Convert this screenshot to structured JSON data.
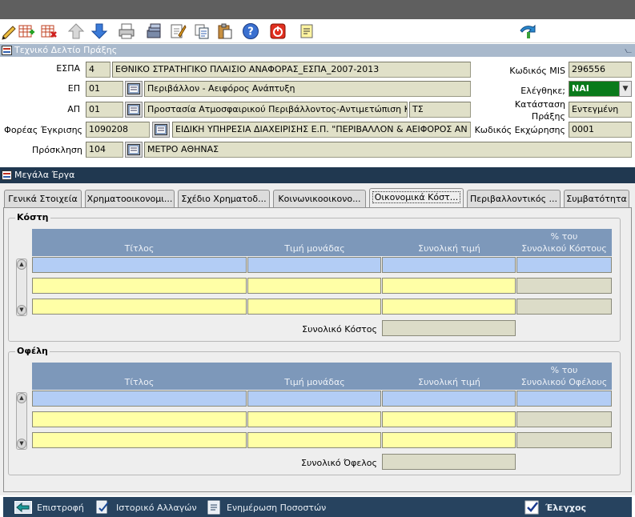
{
  "form": {
    "header_title": "Τεχνικό Δελτίο Πράξης",
    "espa_label": "ΕΣΠΑ",
    "espa_code": "4",
    "espa_desc": "ΕΘΝΙΚΟ ΣΤΡΑΤΗΓΙΚΟ ΠΛΑΙΣΙΟ ΑΝΑΦΟΡΑΣ_ΕΣΠΑ_2007-2013",
    "ep_label": "ΕΠ",
    "ep_code": "01",
    "ep_desc": "Περιβάλλον - Αειφόρος Ανάπτυξη",
    "ap_label": "ΑΠ",
    "ap_code": "01",
    "ap_desc": "Προστασία Ατμοσφαιρικού Περιβάλλοντος-Αντιμετώπιση Κλιμ",
    "ap_extra": "ΤΣ",
    "foreas_label": "Φορέας Έγκρισης",
    "foreas_code": "1090208",
    "foreas_desc": "ΕΙΔΙΚΗ ΥΠΗΡΕΣΙΑ ΔΙΑΧΕΙΡΙΣΗΣ Ε.Π. \"ΠΕΡΙΒΑΛΛΟΝ & ΑΕΙΦΟΡΟΣ ΑΝ",
    "prosklisi_label": "Πρόσκληση",
    "prosklisi_code": "104",
    "prosklisi_desc": "ΜΕΤΡΟ ΑΘΗΝΑΣ",
    "mis_label": "Κωδικός MIS",
    "mis_value": "296556",
    "checked_label": "Ελέγθηκε;",
    "checked_value": "ΝΑΙ",
    "status_label_1": "Κατάσταση",
    "status_label_2": "Πράξης",
    "status_value": "Εντεγμένη",
    "ekxorisi_label": "Κωδικός Εκχώρησης",
    "ekxorisi_value": "0001"
  },
  "section2": {
    "header_title": "Μεγάλα Έργα"
  },
  "tabs": [
    {
      "label": "Γενικά Στοιχεία"
    },
    {
      "label": "Χρηματοοικονομι..."
    },
    {
      "label": "Σχέδιο Χρηματοδ..."
    },
    {
      "label": "Κοινωνικοοικονο..."
    },
    {
      "label": "Οικονομικά Κόστ..."
    },
    {
      "label": "Περιβαλλοντικός ..."
    },
    {
      "label": "Συμβατότητα"
    }
  ],
  "costs": {
    "group_title": "Κόστη",
    "col_title": "Τίτλος",
    "col_unit_price": "Τιμή μονάδας",
    "col_total_price": "Συνολική τιμή",
    "col_pct_1": "% του",
    "col_pct_2": "Συνολικού Κόστους",
    "total_label": "Συνολικό Κόστος"
  },
  "benefits": {
    "group_title": "Οφέλη",
    "col_title": "Τίτλος",
    "col_unit_price": "Τιμή μονάδας",
    "col_total_price": "Συνολική τιμή",
    "col_pct_1": "% του",
    "col_pct_2": "Συνολικού Οφέλους",
    "total_label": "Συνολικό Όφελος"
  },
  "bottombar": {
    "back": "Επιστροφή",
    "history": "Ιστορικό Αλλαγών",
    "update_pct": "Ενημέρωση Ποσοστών",
    "check": "Έλεγχος"
  },
  "icons": [
    "pencil-icon",
    "add-record-icon",
    "delete-record-icon",
    "up-arrow-icon",
    "down-arrow-icon",
    "print-icon",
    "stack-icon",
    "edit-note-icon",
    "copy-icon",
    "paste-icon",
    "help-icon",
    "exit-icon",
    "notes-icon",
    "back-arrow-icon"
  ],
  "colors": {
    "header_light": "#a9b9cc",
    "header_dark": "#203850",
    "field_bg": "#e0e0c8",
    "row_current": "#b3cdf5",
    "row_other": "#ffffa6",
    "yes_green": "#0a7a1a"
  }
}
